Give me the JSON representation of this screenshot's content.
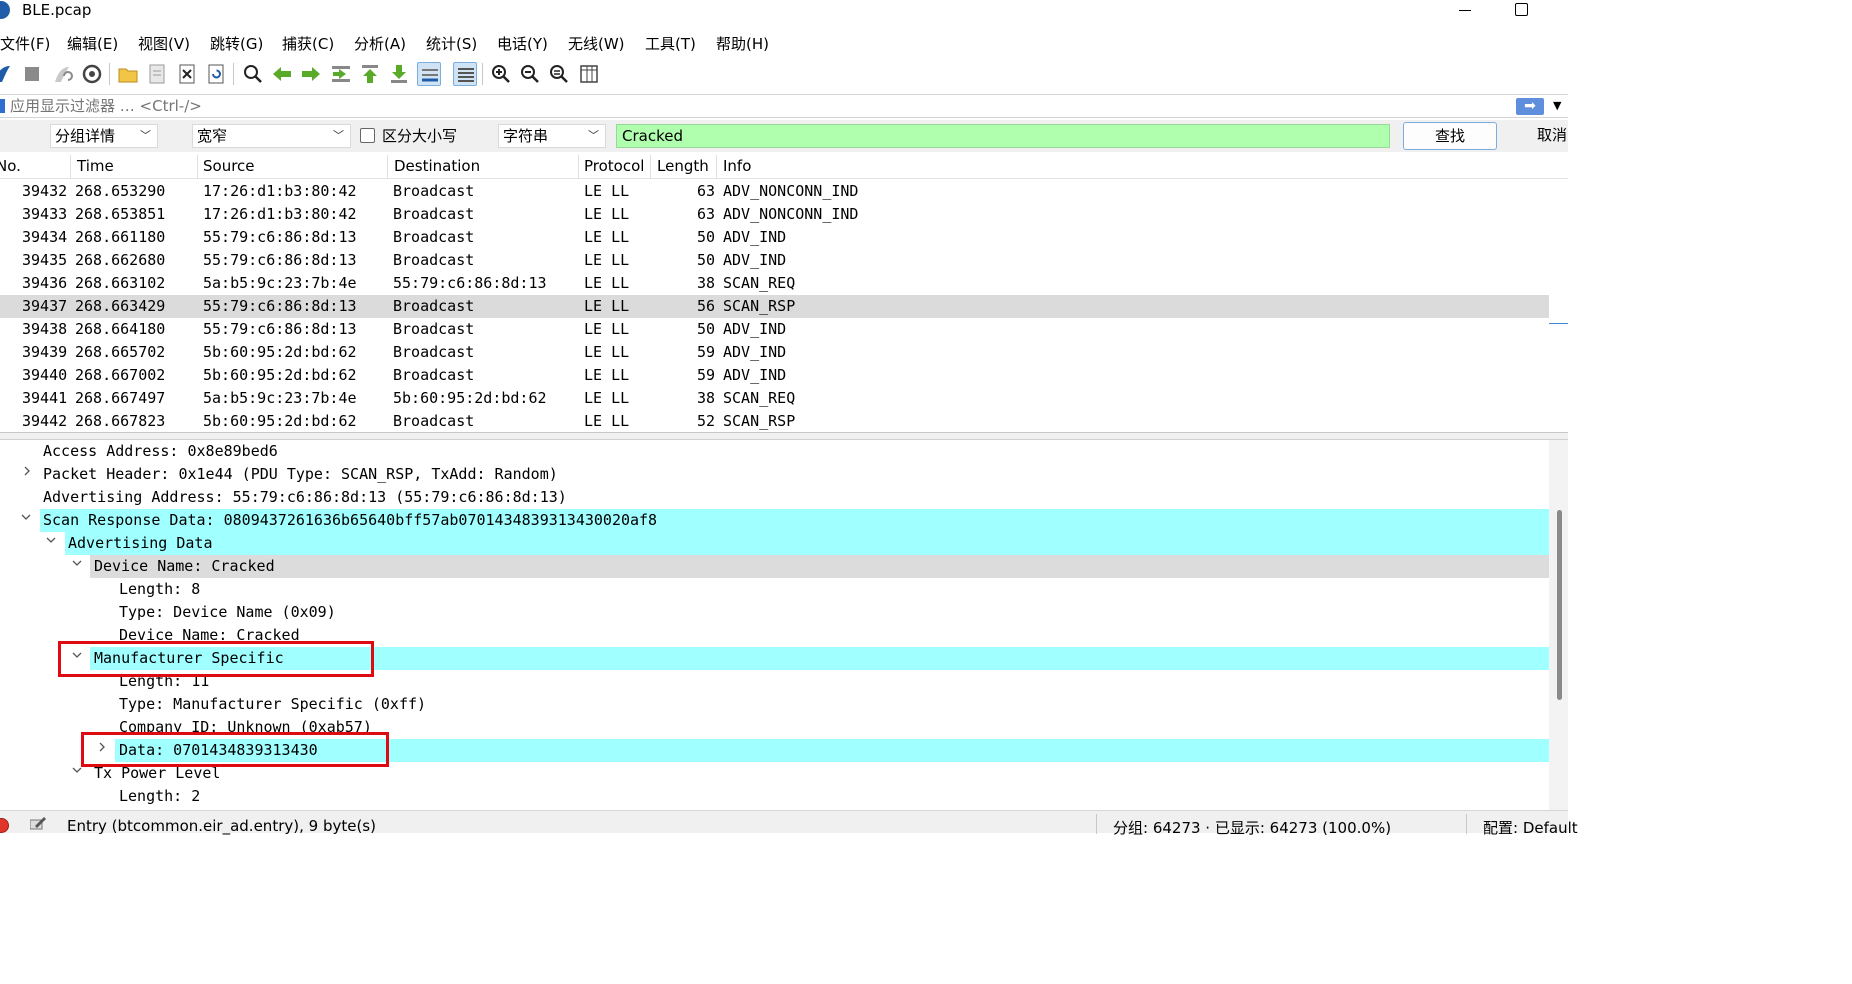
{
  "window": {
    "title": "BLE.pcap"
  },
  "menu": [
    "文件(F)",
    "编辑(E)",
    "视图(V)",
    "跳转(G)",
    "捕获(C)",
    "分析(A)",
    "统计(S)",
    "电话(Y)",
    "无线(W)",
    "工具(T)",
    "帮助(H)"
  ],
  "filter": {
    "placeholder": "应用显示过滤器 … <Ctrl-/>",
    "apply": "➡"
  },
  "find": {
    "search_in": "分组详情",
    "char_width": "宽窄",
    "case_label": "区分大小写",
    "search_type": "字符串",
    "text": "Cracked",
    "find_button": "查找",
    "cancel_button": "取消"
  },
  "packet_list": {
    "columns": [
      "No.",
      "Time",
      "Source",
      "Destination",
      "Protocol",
      "Length",
      "Info"
    ],
    "rows": [
      {
        "no": "39432",
        "time": "268.653290",
        "src": "17:26:d1:b3:80:42",
        "dst": "Broadcast",
        "proto": "LE LL",
        "len": "63",
        "info": "ADV_NONCONN_IND"
      },
      {
        "no": "39433",
        "time": "268.653851",
        "src": "17:26:d1:b3:80:42",
        "dst": "Broadcast",
        "proto": "LE LL",
        "len": "63",
        "info": "ADV_NONCONN_IND"
      },
      {
        "no": "39434",
        "time": "268.661180",
        "src": "55:79:c6:86:8d:13",
        "dst": "Broadcast",
        "proto": "LE LL",
        "len": "50",
        "info": "ADV_IND"
      },
      {
        "no": "39435",
        "time": "268.662680",
        "src": "55:79:c6:86:8d:13",
        "dst": "Broadcast",
        "proto": "LE LL",
        "len": "50",
        "info": "ADV_IND"
      },
      {
        "no": "39436",
        "time": "268.663102",
        "src": "5a:b5:9c:23:7b:4e",
        "dst": "55:79:c6:86:8d:13",
        "proto": "LE LL",
        "len": "38",
        "info": "SCAN_REQ"
      },
      {
        "no": "39437",
        "time": "268.663429",
        "src": "55:79:c6:86:8d:13",
        "dst": "Broadcast",
        "proto": "LE LL",
        "len": "56",
        "info": "SCAN_RSP"
      },
      {
        "no": "39438",
        "time": "268.664180",
        "src": "55:79:c6:86:8d:13",
        "dst": "Broadcast",
        "proto": "LE LL",
        "len": "50",
        "info": "ADV_IND"
      },
      {
        "no": "39439",
        "time": "268.665702",
        "src": "5b:60:95:2d:bd:62",
        "dst": "Broadcast",
        "proto": "LE LL",
        "len": "59",
        "info": "ADV_IND"
      },
      {
        "no": "39440",
        "time": "268.667002",
        "src": "5b:60:95:2d:bd:62",
        "dst": "Broadcast",
        "proto": "LE LL",
        "len": "59",
        "info": "ADV_IND"
      },
      {
        "no": "39441",
        "time": "268.667497",
        "src": "5a:b5:9c:23:7b:4e",
        "dst": "5b:60:95:2d:bd:62",
        "proto": "LE LL",
        "len": "38",
        "info": "SCAN_REQ"
      },
      {
        "no": "39442",
        "time": "268.667823",
        "src": "5b:60:95:2d:bd:62",
        "dst": "Broadcast",
        "proto": "LE LL",
        "len": "52",
        "info": "SCAN_RSP"
      }
    ]
  },
  "detail": [
    {
      "text": "Access Address: 0x8e89bed6",
      "arrow": "none",
      "hl": "none"
    },
    {
      "text": "Packet Header: 0x1e44 (PDU Type: SCAN_RSP, TxAdd: Random)",
      "arrow": "right",
      "hl": "none"
    },
    {
      "text": "Advertising Address: 55:79:c6:86:8d:13 (55:79:c6:86:8d:13)",
      "arrow": "none",
      "hl": "none"
    },
    {
      "text": "Scan Response Data: 0809437261636b65640bff57ab0701434839313430020af8",
      "arrow": "down",
      "hl": "cyan"
    },
    {
      "text": "Advertising Data",
      "arrow": "down",
      "hl": "cyan"
    },
    {
      "text": "Device Name: Cracked",
      "arrow": "down",
      "hl": "grey"
    },
    {
      "text": "Length: 8",
      "arrow": "none",
      "hl": "none"
    },
    {
      "text": "Type: Device Name (0x09)",
      "arrow": "none",
      "hl": "none"
    },
    {
      "text": "Device Name: Cracked",
      "arrow": "none",
      "hl": "none"
    },
    {
      "text": "Manufacturer Specific",
      "arrow": "down",
      "hl": "cyan"
    },
    {
      "text": "Length: 11",
      "arrow": "none",
      "hl": "none"
    },
    {
      "text": "Type: Manufacturer Specific (0xff)",
      "arrow": "none",
      "hl": "none"
    },
    {
      "text": "Company ID: Unknown (0xab57)",
      "arrow": "none",
      "hl": "none"
    },
    {
      "text": "Data: 0701434839313430",
      "arrow": "right",
      "hl": "cyan"
    },
    {
      "text": "Tx Power Level",
      "arrow": "down",
      "hl": "none"
    },
    {
      "text": "Length: 2",
      "arrow": "none",
      "hl": "none"
    }
  ],
  "status": {
    "field": "Entry (btcommon.eir_ad.entry), 9 byte(s)",
    "packets": "分组: 64273 · 已显示: 64273 (100.0%)",
    "profile": "配置: Default"
  },
  "colors": {
    "highlight_cyan": "#a0ffff",
    "selected_row": "#dbdbdb",
    "find_green": "#afffaf",
    "annotation_red": "#e00a12"
  }
}
